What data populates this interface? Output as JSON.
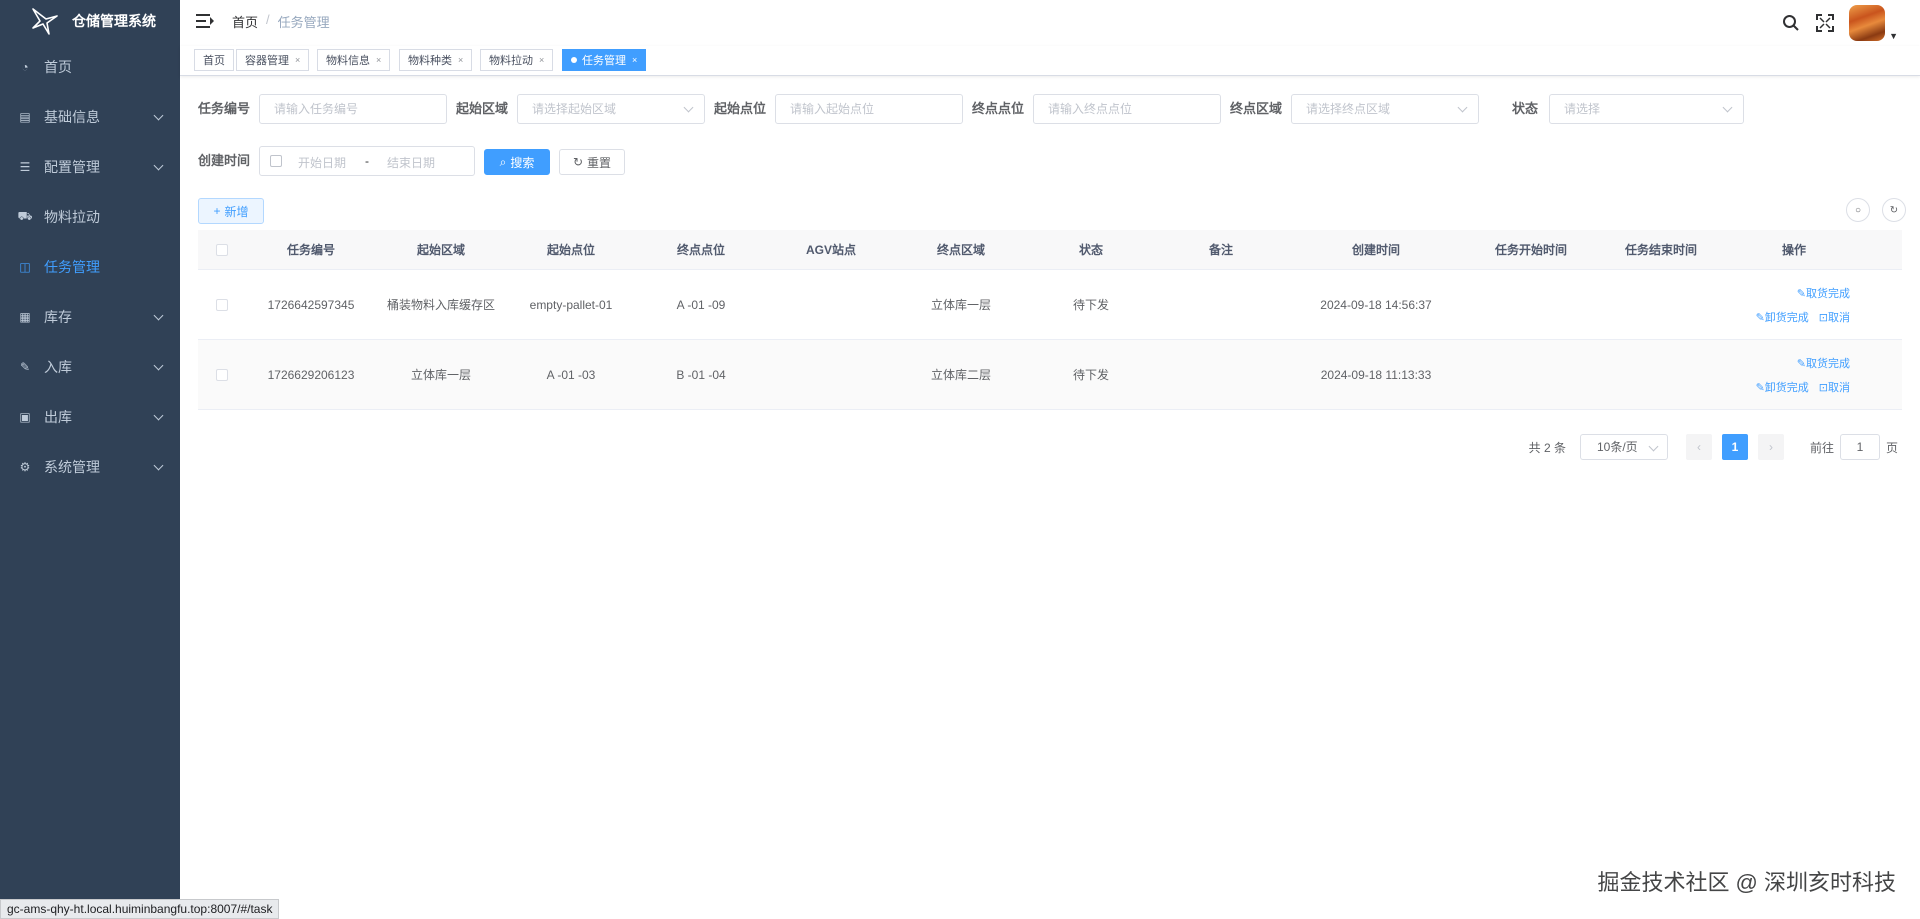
{
  "app": {
    "title": "仓储管理系统"
  },
  "sidebar": {
    "items": [
      {
        "label": "首页",
        "icon": "dashboard-icon",
        "glyph": "◔",
        "submenu": false,
        "active": false
      },
      {
        "label": "基础信息",
        "icon": "document-icon",
        "glyph": "▤",
        "submenu": true,
        "active": false
      },
      {
        "label": "配置管理",
        "icon": "sliders-icon",
        "glyph": "☰",
        "submenu": true,
        "active": false
      },
      {
        "label": "物料拉动",
        "icon": "cart-icon",
        "glyph": "⛟",
        "submenu": false,
        "active": false
      },
      {
        "label": "任务管理",
        "icon": "task-icon",
        "glyph": "◫",
        "submenu": false,
        "active": true
      },
      {
        "label": "库存",
        "icon": "grid-icon",
        "glyph": "▦",
        "submenu": true,
        "active": false
      },
      {
        "label": "入库",
        "icon": "edit-icon",
        "glyph": "✎",
        "submenu": true,
        "active": false
      },
      {
        "label": "出库",
        "icon": "box-icon",
        "glyph": "▣",
        "submenu": true,
        "active": false
      },
      {
        "label": "系统管理",
        "icon": "gear-icon",
        "glyph": "⚙",
        "submenu": true,
        "active": false
      }
    ]
  },
  "breadcrumb": {
    "home": "首页",
    "separator": "/",
    "current": "任务管理"
  },
  "tags": [
    {
      "label": "首页",
      "closable": false,
      "active": false
    },
    {
      "label": "容器管理",
      "closable": true,
      "active": false
    },
    {
      "label": "物料信息",
      "closable": true,
      "active": false
    },
    {
      "label": "物料种类",
      "closable": true,
      "active": false
    },
    {
      "label": "物料拉动",
      "closable": true,
      "active": false
    },
    {
      "label": "任务管理",
      "closable": true,
      "active": true
    }
  ],
  "filters": {
    "task_no": {
      "label": "任务编号",
      "placeholder": "请输入任务编号"
    },
    "start_area": {
      "label": "起始区域",
      "placeholder": "请选择起始区域"
    },
    "start_point": {
      "label": "起始点位",
      "placeholder": "请输入起始点位"
    },
    "end_point": {
      "label": "终点点位",
      "placeholder": "请输入终点点位"
    },
    "end_area": {
      "label": "终点区域",
      "placeholder": "请选择终点区域"
    },
    "status": {
      "label": "状态",
      "placeholder": "请选择"
    },
    "created": {
      "label": "创建时间",
      "start_placeholder": "开始日期",
      "separator": "-",
      "end_placeholder": "结束日期"
    },
    "search_label": "搜索",
    "reset_label": "重置"
  },
  "toolbar": {
    "add_label": "新增"
  },
  "table": {
    "columns": [
      "任务编号",
      "起始区域",
      "起始点位",
      "终点点位",
      "AGV站点",
      "终点区域",
      "状态",
      "备注",
      "创建时间",
      "任务开始时间",
      "任务结束时间",
      "操作"
    ],
    "rows": [
      {
        "task_no": "1726642597345",
        "start_area": "桶装物料入库缓存区",
        "start_point": "empty-pallet-01",
        "end_point": "A -01 -09",
        "agv": "",
        "end_area": "立体库一层",
        "status": "待下发",
        "remark": "",
        "created": "2024-09-18 14:56:37",
        "started": "",
        "ended": ""
      },
      {
        "task_no": "1726629206123",
        "start_area": "立体库一层",
        "start_point": "A -01 -03",
        "end_point": "B -01 -04",
        "agv": "",
        "end_area": "立体库二层",
        "status": "待下发",
        "remark": "",
        "created": "2024-09-18 11:13:33",
        "started": "",
        "ended": ""
      }
    ],
    "actions": {
      "pickup_done": "取货完成",
      "unload_done": "卸货完成",
      "cancel": "取消"
    }
  },
  "pagination": {
    "total_text": "共 2 条",
    "page_size": "10条/页",
    "current_page": "1",
    "goto_label": "前往",
    "goto_value": "1",
    "page_suffix": "页"
  },
  "status_bar": {
    "url": "gc-ams-qhy-ht.local.huiminbangfu.top:8007/#/task"
  },
  "watermark": "掘金技术社区 @ 深圳亥时科技",
  "colors": {
    "sidebar_bg": "#304156",
    "primary": "#409eff",
    "tag_active": "#409eff"
  }
}
